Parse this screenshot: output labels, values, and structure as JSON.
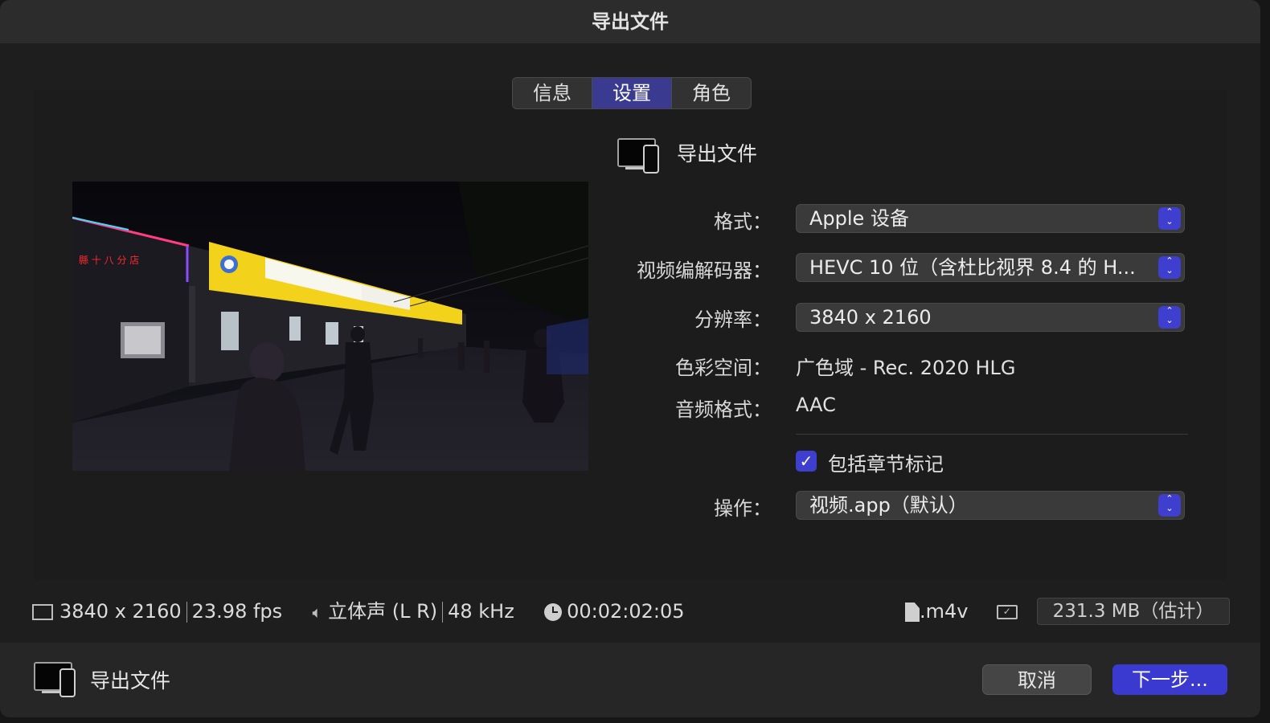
{
  "window": {
    "title": "导出文件"
  },
  "tabs": [
    {
      "label": "信息",
      "active": false
    },
    {
      "label": "设置",
      "active": true
    },
    {
      "label": "角色",
      "active": false
    }
  ],
  "destination": {
    "title": "导出文件",
    "icon": "monitor-phone-icon"
  },
  "settings": {
    "format": {
      "label": "格式：",
      "value": "Apple 设备"
    },
    "codec": {
      "label": "视频编解码器：",
      "value": "HEVC 10 位（含杜比视界 8.4 的 H..."
    },
    "resolution": {
      "label": "分辨率：",
      "value": "3840 x 2160"
    },
    "color_space": {
      "label": "色彩空间：",
      "value": "广色域 - Rec. 2020 HLG"
    },
    "audio_format": {
      "label": "音频格式：",
      "value": "AAC"
    },
    "chapter_markers": {
      "label": "包括章节标记",
      "checked": true
    },
    "action": {
      "label": "操作：",
      "value": "视频.app（默认）"
    }
  },
  "info_bar": {
    "resolution": "3840 x 2160",
    "fps": "23.98 fps",
    "audio_channels": "立体声 (L R)",
    "sample_rate": "48 kHz",
    "duration": "00:02:02:05",
    "extension": ".m4v",
    "size": "231.3 MB（估计）"
  },
  "footer": {
    "title": "导出文件",
    "cancel_label": "取消",
    "next_label": "下一步..."
  },
  "colors": {
    "accent": "#3f3fcf",
    "active_tab": "#3a3a90"
  }
}
